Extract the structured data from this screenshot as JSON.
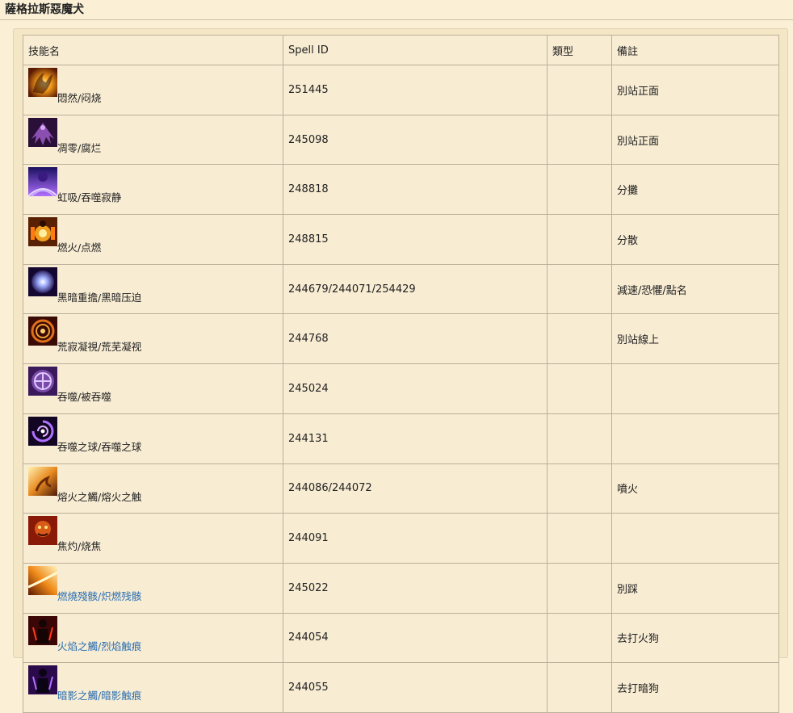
{
  "page": {
    "title": "薩格拉斯惡魔犬"
  },
  "table": {
    "headers": [
      "技能名",
      "Spell ID",
      "類型",
      "備註"
    ],
    "rows": [
      {
        "name": "悶然/闷烧",
        "spell_id": "251445",
        "type": "",
        "note": "別站正面",
        "icon": "smolder-flame-icon",
        "link": false
      },
      {
        "name": "凋零/腐烂",
        "spell_id": "245098",
        "type": "",
        "note": "別站正面",
        "icon": "decay-wings-icon",
        "link": false
      },
      {
        "name": "虹吸/吞噬寂静",
        "spell_id": "248818",
        "type": "",
        "note": "分攤",
        "icon": "siphon-void-icon",
        "link": false
      },
      {
        "name": "燃火/点燃",
        "spell_id": "248815",
        "type": "",
        "note": "分散",
        "icon": "enflame-body-icon",
        "link": false
      },
      {
        "name": "黑暗重擔/黑暗压迫",
        "spell_id": "244679/244071/254429",
        "type": "",
        "note": "減速/恐懼/點名",
        "icon": "dark-orb-icon",
        "link": false
      },
      {
        "name": "荒寂凝視/荒芜凝视",
        "spell_id": "244768",
        "type": "",
        "note": "別站線上",
        "icon": "desolate-gaze-icon",
        "link": false
      },
      {
        "name": "吞噬/被吞噬",
        "spell_id": "245024",
        "type": "",
        "note": "",
        "icon": "consume-rune-icon",
        "link": false
      },
      {
        "name": "吞噬之球/吞噬之球",
        "spell_id": "244131",
        "type": "",
        "note": "",
        "icon": "consuming-sphere-icon",
        "link": false
      },
      {
        "name": "熔火之觸/熔火之触",
        "spell_id": "244086/244072",
        "type": "",
        "note": "噴火",
        "icon": "molten-touch-icon",
        "link": false
      },
      {
        "name": "焦灼/烧焦",
        "spell_id": "244091",
        "type": "",
        "note": "",
        "icon": "singed-demon-icon",
        "link": false
      },
      {
        "name": "燃燒殘骸/炽燃残骸",
        "spell_id": "245022",
        "type": "",
        "note": "別踩",
        "icon": "burning-remnant-icon",
        "link": true
      },
      {
        "name": "火焰之觸/烈焰触痕",
        "spell_id": "244054",
        "type": "",
        "note": "去打火狗",
        "icon": "flametouched-icon",
        "link": true
      },
      {
        "name": "暗影之觸/暗影触痕",
        "spell_id": "244055",
        "type": "",
        "note": "去打暗狗",
        "icon": "shadowtouched-icon",
        "link": true
      }
    ]
  }
}
